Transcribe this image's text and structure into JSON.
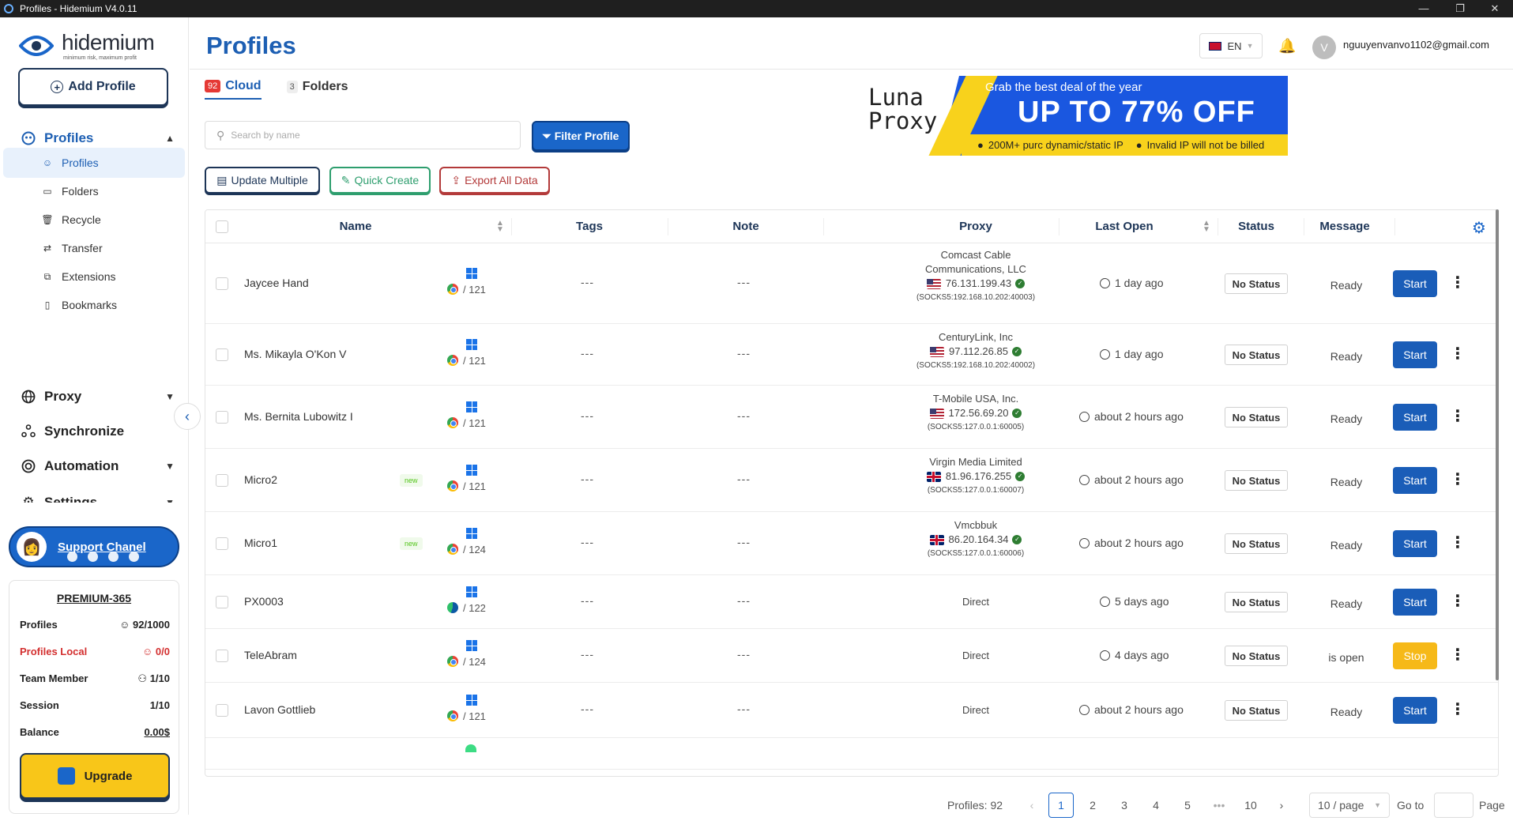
{
  "window": {
    "title": "Profiles - Hidemium V4.0.11",
    "controls": [
      "—",
      "❐",
      "✕"
    ]
  },
  "sidebar": {
    "logo": {
      "name": "hidemium",
      "tagline": "minimum risk, maximum profit"
    },
    "add_profile": "Add Profile",
    "sections": {
      "profiles": "Profiles",
      "proxy": "Proxy",
      "synchronize": "Synchronize",
      "automation": "Automation",
      "settings": "Settings"
    },
    "profile_items": [
      {
        "label": "Profiles",
        "icon": "profiles-icon"
      },
      {
        "label": "Folders",
        "icon": "folder-icon"
      },
      {
        "label": "Recycle",
        "icon": "trash-icon"
      },
      {
        "label": "Transfer",
        "icon": "transfer-icon"
      },
      {
        "label": "Extensions",
        "icon": "extension-icon"
      },
      {
        "label": "Bookmarks",
        "icon": "bookmark-icon"
      }
    ],
    "support": "Support Chanel",
    "plan": {
      "name": "PREMIUM-365",
      "rows": [
        {
          "label": "Profiles",
          "value": "92/1000"
        },
        {
          "label": "Profiles Local",
          "value": "0/0"
        },
        {
          "label": "Team Member",
          "value": "1/10"
        },
        {
          "label": "Session",
          "value": "1/10"
        },
        {
          "label": "Balance",
          "value": "0.00$"
        }
      ],
      "upgrade": "Upgrade"
    }
  },
  "header": {
    "page_title": "Profiles",
    "language": "EN",
    "avatar_letter": "V",
    "email": "nguuyenvanvo1102@gmail.com"
  },
  "tabs": {
    "cloud": {
      "count": "92",
      "label": "Cloud"
    },
    "folders": {
      "count": "3",
      "label": "Folders"
    }
  },
  "search": {
    "placeholder": "Search by name"
  },
  "buttons": {
    "filter": "Filter Profile",
    "update_multiple": "Update Multiple",
    "quick_create": "Quick Create",
    "export_all": "Export All Data"
  },
  "banner": {
    "brand_line1": "Luna",
    "brand_line2": "Proxy",
    "headline": "Grab the best deal of the year",
    "offer": "UP TO 77% OFF",
    "bullet1": "200M+ purc dynamic/static IP",
    "bullet2": "Invalid IP will not be billed",
    "accent": "#f8d21c"
  },
  "table": {
    "headers": {
      "name": "Name",
      "tags": "Tags",
      "note": "Note",
      "proxy": "Proxy",
      "last_open": "Last Open",
      "status": "Status",
      "message": "Message"
    },
    "rows": [
      {
        "name": "Jaycee Hand",
        "new": "",
        "os": "windows",
        "browser": "chrome",
        "version": "/ 121",
        "tags": "---",
        "note": "---",
        "isp": "Comcast Cable Communications, LLC",
        "flag": "us",
        "ip": "76.131.199.43",
        "socks": "(SOCKS5:192.168.10.202:40003)",
        "last_open": "1 day ago",
        "status": "No Status",
        "message": "Ready",
        "action": "Start"
      },
      {
        "name": "Ms. Mikayla O'Kon V",
        "new": "",
        "os": "windows",
        "browser": "chrome",
        "version": "/ 121",
        "tags": "---",
        "note": "---",
        "isp": "CenturyLink, Inc",
        "flag": "us",
        "ip": "97.112.26.85",
        "socks": "(SOCKS5:192.168.10.202:40002)",
        "last_open": "1 day ago",
        "status": "No Status",
        "message": "Ready",
        "action": "Start"
      },
      {
        "name": "Ms. Bernita Lubowitz I",
        "new": "",
        "os": "windows",
        "browser": "chrome",
        "version": "/ 121",
        "tags": "---",
        "note": "---",
        "isp": "T-Mobile USA, Inc.",
        "flag": "us",
        "ip": "172.56.69.20",
        "socks": "(SOCKS5:127.0.0.1:60005)",
        "last_open": "about 2 hours ago",
        "status": "No Status",
        "message": "Ready",
        "action": "Start"
      },
      {
        "name": "Micro2",
        "new": "new",
        "os": "windows",
        "browser": "chrome",
        "version": "/ 121",
        "tags": "---",
        "note": "---",
        "isp": "Virgin Media Limited",
        "flag": "gb",
        "ip": "81.96.176.255",
        "socks": "(SOCKS5:127.0.0.1:60007)",
        "last_open": "about 2 hours ago",
        "status": "No Status",
        "message": "Ready",
        "action": "Start"
      },
      {
        "name": "Micro1",
        "new": "new",
        "os": "windows",
        "browser": "chrome",
        "version": "/ 124",
        "tags": "---",
        "note": "---",
        "isp": "Vmcbbuk",
        "flag": "gb",
        "ip": "86.20.164.34",
        "socks": "(SOCKS5:127.0.0.1:60006)",
        "last_open": "about 2 hours ago",
        "status": "No Status",
        "message": "Ready",
        "action": "Start"
      },
      {
        "name": "PX0003",
        "new": "",
        "os": "windows",
        "browser": "edge",
        "version": "/ 122",
        "tags": "---",
        "note": "---",
        "isp": "Direct",
        "flag": "",
        "ip": "",
        "socks": "",
        "last_open": "5 days ago",
        "status": "No Status",
        "message": "Ready",
        "action": "Start"
      },
      {
        "name": "TeleAbram",
        "new": "",
        "os": "windows",
        "browser": "chrome",
        "version": "/ 124",
        "tags": "---",
        "note": "---",
        "isp": "Direct",
        "flag": "",
        "ip": "",
        "socks": "",
        "last_open": "4 days ago",
        "status": "No Status",
        "message": "is open",
        "action": "Stop"
      },
      {
        "name": "Lavon Gottlieb",
        "new": "",
        "os": "windows",
        "browser": "chrome",
        "version": "/ 121",
        "tags": "---",
        "note": "---",
        "isp": "Direct",
        "flag": "",
        "ip": "",
        "socks": "",
        "last_open": "about 2 hours ago",
        "status": "No Status",
        "message": "Ready",
        "action": "Start"
      }
    ]
  },
  "pagination": {
    "total": "Profiles: 92",
    "pages": [
      "1",
      "2",
      "3",
      "4",
      "5",
      "•••",
      "10"
    ],
    "page_size": "10 / page",
    "goto": "Go to",
    "page": "Page"
  }
}
